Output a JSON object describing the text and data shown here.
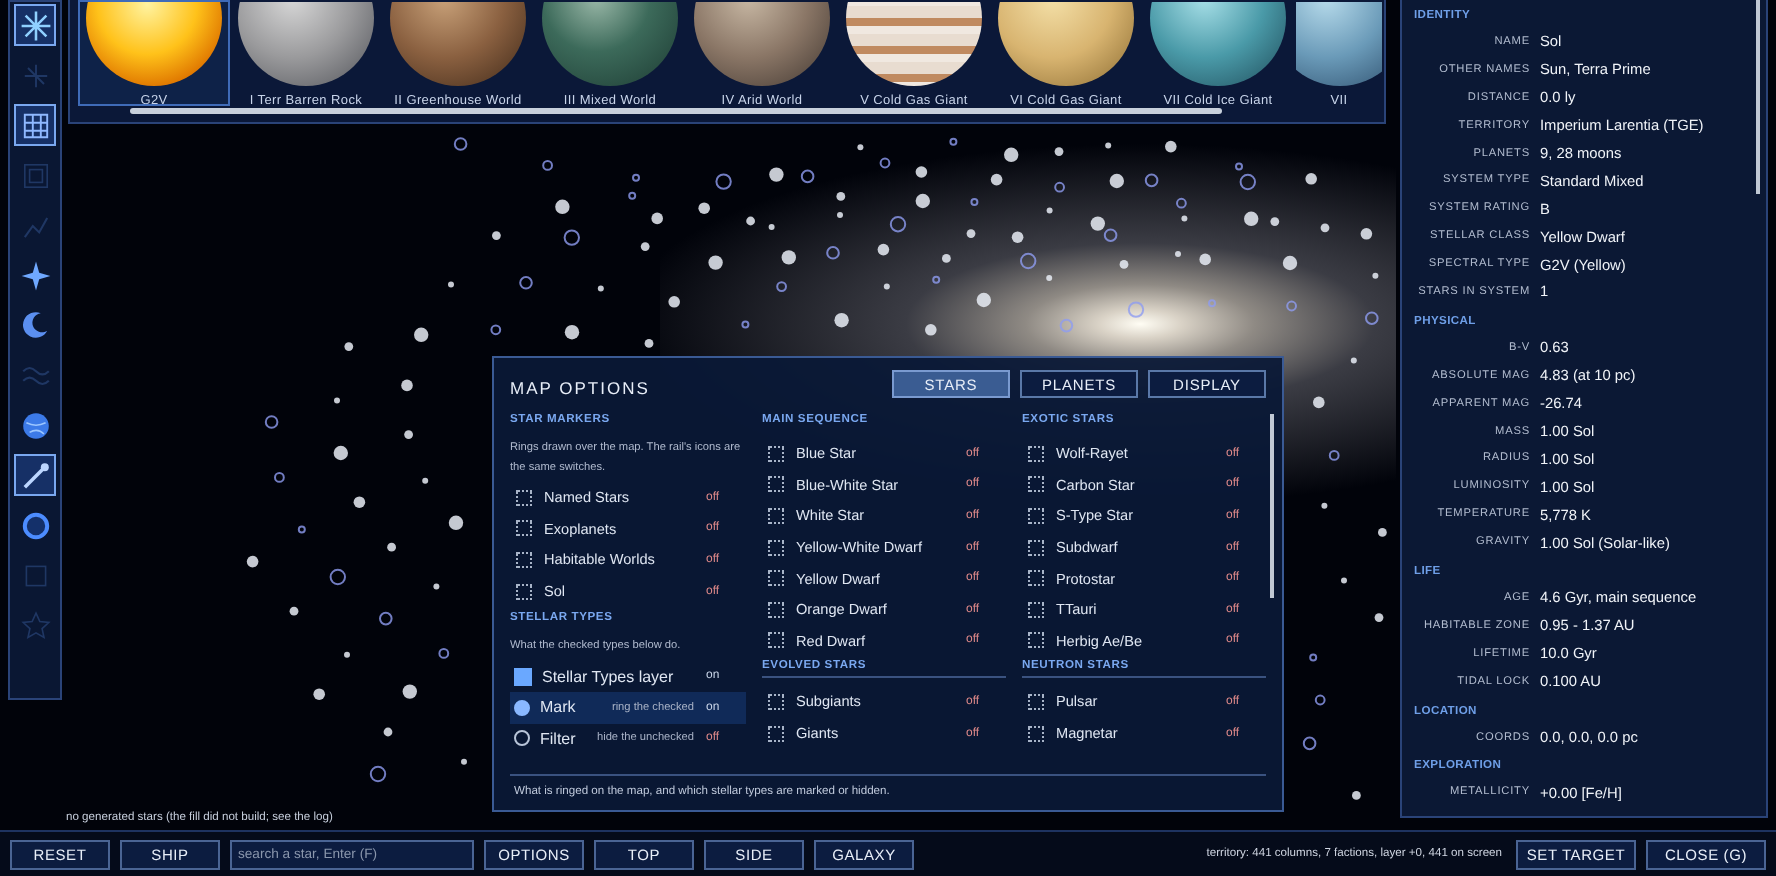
{
  "rail": [
    {
      "kind": "star",
      "active": true,
      "selected": true
    },
    {
      "kind": "network",
      "active": false,
      "selected": false
    },
    {
      "kind": "grid",
      "active": true,
      "selected": true
    },
    {
      "kind": "frame",
      "active": false,
      "selected": false
    },
    {
      "kind": "chart",
      "active": false,
      "selected": false
    },
    {
      "kind": "sparkle",
      "active": true,
      "selected": false
    },
    {
      "kind": "crescent",
      "active": true,
      "selected": false
    },
    {
      "kind": "waves",
      "active": false,
      "selected": false
    },
    {
      "kind": "globe",
      "active": true,
      "selected": false
    },
    {
      "kind": "wand",
      "active": true,
      "selected": true
    },
    {
      "kind": "ring",
      "active": true,
      "selected": false
    },
    {
      "kind": "square",
      "active": false,
      "selected": false
    },
    {
      "kind": "star_outline",
      "active": false,
      "selected": false
    }
  ],
  "planets": [
    {
      "kind": "sun",
      "label": "G2V",
      "selected": true
    },
    {
      "kind": "rock",
      "label": "I  Terr Barren Rock",
      "selected": false
    },
    {
      "kind": "greenhouse",
      "label": "II  Greenhouse World",
      "selected": false
    },
    {
      "kind": "mixed",
      "label": "III  Mixed World",
      "selected": false
    },
    {
      "kind": "arid",
      "label": "IV  Arid World",
      "selected": false
    },
    {
      "kind": "banded",
      "label": "V  Cold Gas Giant",
      "selected": false
    },
    {
      "kind": "gas",
      "label": "VI  Cold Gas Giant",
      "selected": false
    },
    {
      "kind": "ice",
      "label": "VII  Cold Ice Giant",
      "selected": false
    },
    {
      "kind": "ice2",
      "label": "VII",
      "selected": false
    }
  ],
  "info": {
    "sections": [
      {
        "title": "IDENTITY",
        "rows": [
          [
            "NAME",
            "Sol"
          ],
          [
            "OTHER NAMES",
            "Sun, Terra Prime"
          ],
          [
            "DISTANCE",
            "0.0 ly"
          ],
          [
            "TERRITORY",
            "Imperium Larentia (TGE)"
          ],
          [
            "PLANETS",
            "9, 28 moons"
          ],
          [
            "SYSTEM TYPE",
            "Standard Mixed"
          ],
          [
            "SYSTEM RATING",
            "B"
          ],
          [
            "STELLAR CLASS",
            "Yellow Dwarf"
          ],
          [
            "SPECTRAL TYPE",
            "G2V (Yellow)"
          ],
          [
            "STARS IN SYSTEM",
            "1"
          ]
        ]
      },
      {
        "title": "PHYSICAL",
        "rows": [
          [
            "B-V",
            "0.63"
          ],
          [
            "ABSOLUTE MAG",
            "4.83 (at 10 pc)"
          ],
          [
            "APPARENT MAG",
            "-26.74"
          ],
          [
            "MASS",
            "1.00 Sol"
          ],
          [
            "RADIUS",
            "1.00 Sol"
          ],
          [
            "LUMINOSITY",
            "1.00 Sol"
          ],
          [
            "TEMPERATURE",
            "5,778 K"
          ],
          [
            "GRAVITY",
            "1.00 Sol (Solar-like)"
          ]
        ]
      },
      {
        "title": "LIFE",
        "rows": [
          [
            "AGE",
            "4.6 Gyr, main sequence"
          ],
          [
            "HABITABLE ZONE",
            "0.95 - 1.37 AU"
          ],
          [
            "LIFETIME",
            "10.0 Gyr"
          ],
          [
            "TIDAL LOCK",
            "0.100 AU"
          ]
        ]
      },
      {
        "title": "LOCATION",
        "rows": [
          [
            "COORDS",
            "0.0, 0.0, 0.0 pc"
          ]
        ]
      },
      {
        "title": "EXPLORATION",
        "rows": [
          [
            "METALLICITY",
            "+0.00 [Fe/H]"
          ]
        ]
      }
    ]
  },
  "map_options": {
    "title": "MAP OPTIONS",
    "tabs": [
      {
        "label": "STARS",
        "selected": true
      },
      {
        "label": "PLANETS",
        "selected": false
      },
      {
        "label": "DISPLAY",
        "selected": false
      }
    ],
    "columns": [
      {
        "groups": [
          {
            "heading": "STAR MARKERS",
            "description": "Rings drawn over the map. The rail's icons are the same switches.",
            "items": [
              {
                "kind": "check",
                "label": "Named Stars",
                "state": "off",
                "on": false
              },
              {
                "kind": "check",
                "label": "Exoplanets",
                "state": "off",
                "on": false
              },
              {
                "kind": "check",
                "label": "Habitable Worlds",
                "state": "off",
                "on": false
              },
              {
                "kind": "check",
                "label": "Sol",
                "state": "off",
                "on": false
              }
            ]
          },
          {
            "heading": "STELLAR TYPES",
            "description": "What the checked types below do.",
            "items": [
              {
                "kind": "layer",
                "label": "Stellar Types layer",
                "state": "on",
                "on": true,
                "selected": false
              },
              {
                "kind": "radio",
                "label": "Mark",
                "hint": "ring the checked",
                "state": "on",
                "on": true,
                "selected": true
              },
              {
                "kind": "radio",
                "label": "Filter",
                "hint": "hide the unchecked",
                "state": "off",
                "on": false,
                "selected": false
              }
            ]
          }
        ]
      },
      {
        "groups": [
          {
            "heading": "MAIN SEQUENCE",
            "items": [
              {
                "kind": "check",
                "label": "Blue Star",
                "state": "off",
                "on": false
              },
              {
                "kind": "check",
                "label": "Blue-White Star",
                "state": "off",
                "on": false
              },
              {
                "kind": "check",
                "label": "White Star",
                "state": "off",
                "on": false
              },
              {
                "kind": "check",
                "label": "Yellow-White Dwarf",
                "state": "off",
                "on": false
              },
              {
                "kind": "check",
                "label": "Yellow Dwarf",
                "state": "off",
                "on": false
              },
              {
                "kind": "check",
                "label": "Orange Dwarf",
                "state": "off",
                "on": false
              },
              {
                "kind": "check",
                "label": "Red Dwarf",
                "state": "off",
                "on": false
              }
            ]
          },
          {
            "heading": "EVOLVED STARS",
            "items": [
              {
                "kind": "check",
                "label": "Subgiants",
                "state": "off",
                "on": false
              },
              {
                "kind": "check",
                "label": "Giants",
                "state": "off",
                "on": false
              }
            ]
          }
        ]
      },
      {
        "groups": [
          {
            "heading": "EXOTIC STARS",
            "items": [
              {
                "kind": "check",
                "label": "Wolf-Rayet",
                "state": "off",
                "on": false
              },
              {
                "kind": "check",
                "label": "Carbon Star",
                "state": "off",
                "on": false
              },
              {
                "kind": "check",
                "label": "S-Type Star",
                "state": "off",
                "on": false
              },
              {
                "kind": "check",
                "label": "Subdwarf",
                "state": "off",
                "on": false
              },
              {
                "kind": "check",
                "label": "Protostar",
                "state": "off",
                "on": false
              },
              {
                "kind": "check",
                "label": "TTauri",
                "state": "off",
                "on": false
              },
              {
                "kind": "check",
                "label": "Herbig Ae/Be",
                "state": "off",
                "on": false
              }
            ]
          },
          {
            "heading": "NEUTRON STARS",
            "items": [
              {
                "kind": "check",
                "label": "Pulsar",
                "state": "off",
                "on": false
              },
              {
                "kind": "check",
                "label": "Magnetar",
                "state": "off",
                "on": false
              }
            ]
          }
        ]
      }
    ],
    "footer": "What is ringed on the map, and which stellar types are marked or hidden."
  },
  "log_message": "no generated stars (the fill did not build; see the log)",
  "bottom_bar": {
    "left_buttons": [
      "RESET",
      "SHIP"
    ],
    "search": {
      "placeholder": "search a star, Enter (F)"
    },
    "view_buttons": [
      "OPTIONS",
      "TOP",
      "SIDE",
      "GALAXY"
    ],
    "status": "territory: 441 columns, 7 factions, layer +0, 441 on screen",
    "right_buttons": [
      "SET TARGET",
      "CLOSE (G)"
    ]
  }
}
